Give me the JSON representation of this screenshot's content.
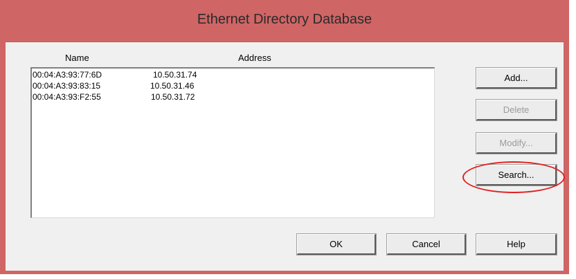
{
  "window": {
    "title": "Ethernet Directory Database"
  },
  "list": {
    "columns": [
      "Name",
      "Address"
    ],
    "rows": [
      {
        "name": "00:04:A3:93:77:6D",
        "address": "10.50.31.74"
      },
      {
        "name": "00:04:A3:93:83:15",
        "address": "10.50.31.46"
      },
      {
        "name": "00:04:A3:93:F2:55",
        "address": "10.50.31.72"
      }
    ]
  },
  "buttons": {
    "add": "Add...",
    "delete": "Delete",
    "modify": "Modify...",
    "search": "Search...",
    "ok": "OK",
    "cancel": "Cancel",
    "help": "Help"
  },
  "colors": {
    "title_bar": "#d06565",
    "highlight": "#e02020"
  }
}
